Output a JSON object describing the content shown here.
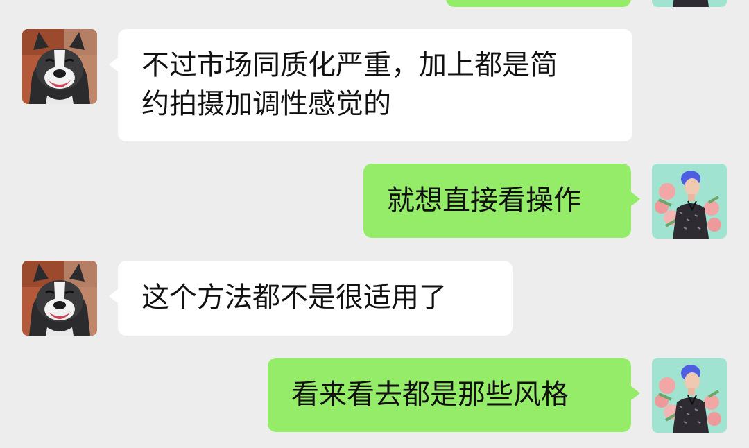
{
  "colors": {
    "background": "#ededed",
    "incoming_bubble": "#ffffff",
    "outgoing_bubble": "#95ec69",
    "text": "#111111"
  },
  "messages": [
    {
      "direction": "outgoing",
      "text": "",
      "avatar": "person-flowers-avatar"
    },
    {
      "direction": "incoming",
      "text": "不过市场同质化严重，加上都是简约拍摄加调性感觉的",
      "avatar": "dog-avatar"
    },
    {
      "direction": "outgoing",
      "text": "就想直接看操作",
      "avatar": "person-flowers-avatar"
    },
    {
      "direction": "incoming",
      "text": "这个方法都不是很适用了",
      "avatar": "dog-avatar"
    },
    {
      "direction": "outgoing",
      "text": "看来看去都是那些风格",
      "avatar": "person-flowers-avatar"
    }
  ],
  "line_breaks": {
    "msg1_line1": "不过市场同质化严重，加上都是简",
    "msg1_line2": "约拍摄加调性感觉的"
  }
}
